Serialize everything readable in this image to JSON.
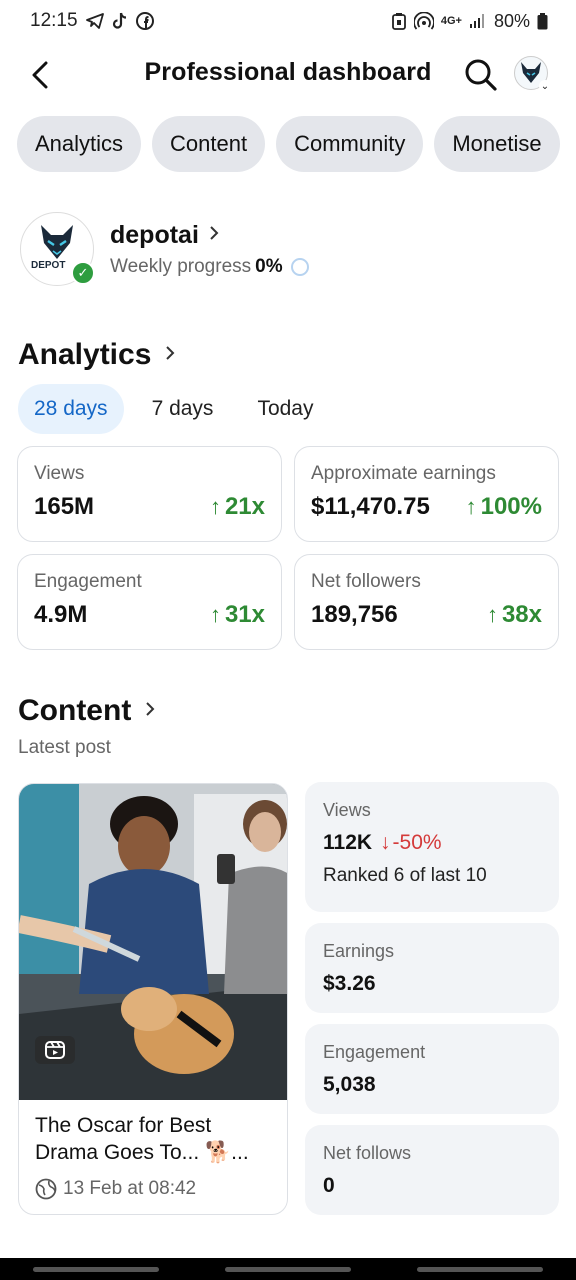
{
  "status_bar": {
    "time": "12:15",
    "battery": "80%",
    "network": "4G+"
  },
  "header": {
    "title": "Professional dashboard"
  },
  "tabs": [
    {
      "label": "Analytics"
    },
    {
      "label": "Content"
    },
    {
      "label": "Community"
    },
    {
      "label": "Monetise"
    }
  ],
  "profile": {
    "name": "depotai",
    "avatar_text": "DEPOT",
    "progress_label": "Weekly progress",
    "progress_value": "0%"
  },
  "analytics": {
    "title": "Analytics",
    "periods": [
      {
        "label": "28 days",
        "active": true
      },
      {
        "label": "7 days",
        "active": false
      },
      {
        "label": "Today",
        "active": false
      }
    ],
    "metrics": [
      {
        "label": "Views",
        "value": "165M",
        "change": "21x"
      },
      {
        "label": "Approximate earnings",
        "value": "$11,470.75",
        "change": "100%"
      },
      {
        "label": "Engagement",
        "value": "4.9M",
        "change": "31x"
      },
      {
        "label": "Net followers",
        "value": "189,756",
        "change": "38x"
      }
    ]
  },
  "content": {
    "title": "Content",
    "subtitle": "Latest post",
    "post": {
      "title": "The Oscar for Best Drama Goes To... 🐕...",
      "date": "13 Feb at 08:42"
    },
    "stats": {
      "views": {
        "label": "Views",
        "value": "112K",
        "change": "-50%",
        "rank": "Ranked 6 of last 10"
      },
      "earnings": {
        "label": "Earnings",
        "value": "$3.26"
      },
      "engagement": {
        "label": "Engagement",
        "value": "5,038"
      },
      "net_follows": {
        "label": "Net follows",
        "value": "0"
      }
    }
  },
  "colors": {
    "positive": "#2e8a34",
    "negative": "#d43a3a",
    "active_tab_bg": "#e7f2fd",
    "active_tab_text": "#1467c7",
    "pill_bg": "#e4e6eb"
  }
}
